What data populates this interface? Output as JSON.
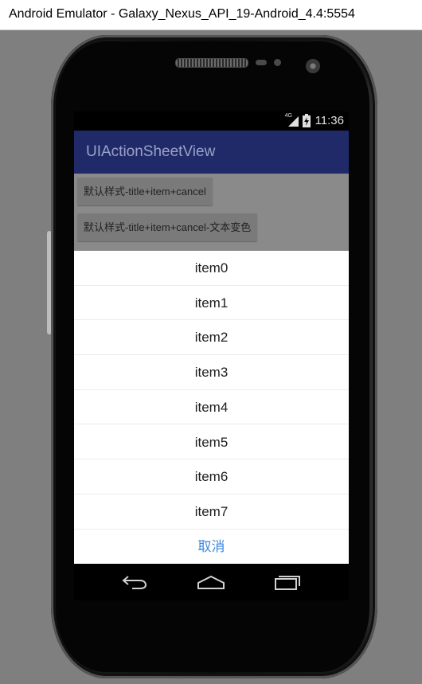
{
  "window": {
    "title": "Android Emulator - Galaxy_Nexus_API_19-Android_4.4:5554"
  },
  "status_bar": {
    "network_label": "4G",
    "time": "11:36"
  },
  "action_bar": {
    "title": "UIActionSheetView"
  },
  "content": {
    "buttons": [
      {
        "label": "默认样式-title+item+cancel"
      },
      {
        "label": "默认样式-title+item+cancel-文本变色"
      }
    ]
  },
  "action_sheet": {
    "items": [
      {
        "label": "item0"
      },
      {
        "label": "item1"
      },
      {
        "label": "item2"
      },
      {
        "label": "item3"
      },
      {
        "label": "item4"
      },
      {
        "label": "item5"
      },
      {
        "label": "item6"
      },
      {
        "label": "item7"
      }
    ],
    "cancel_label": "取消",
    "cancel_color": "#3b86e0"
  },
  "nav_bar": {
    "icons": [
      "back-icon",
      "home-icon",
      "recent-apps-icon"
    ]
  },
  "colors": {
    "action_bar": "#202a68",
    "dim_overlay": "#8a8a8a"
  }
}
